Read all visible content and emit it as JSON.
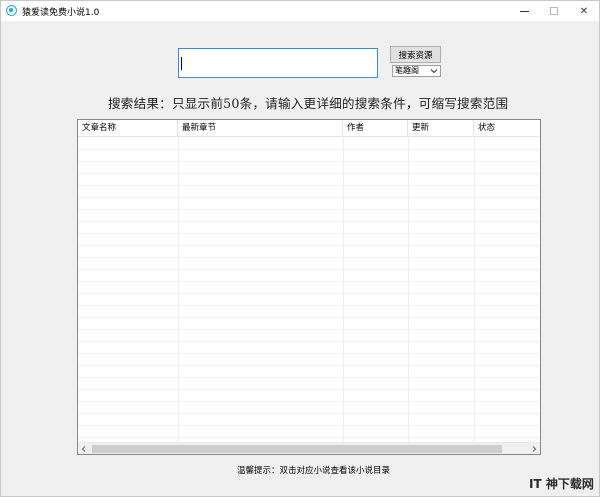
{
  "window": {
    "title": "猿爱读免费小说1.0",
    "controls": {
      "minimize_icon": "minimize-icon",
      "maximize_icon": "maximize-icon",
      "close_glyph": "✕"
    }
  },
  "search": {
    "input_value": "",
    "button_label": "搜索资源",
    "source_select": {
      "selected": "笔趣阁",
      "arrow_icon": "chevron-down-icon"
    }
  },
  "results": {
    "note": "搜索结果：只显示前50条，请输入更详细的搜索条件，可缩写搜索范围",
    "columns": [
      "文章名称",
      "最新章节",
      "作者",
      "更新",
      "状态"
    ],
    "rows": []
  },
  "footer": {
    "tip": "温馨提示：双击对应小说查看该小说目录"
  },
  "watermark": {
    "text": "IT 神下载网"
  },
  "colors": {
    "accent": "#3c8ad8",
    "window_bg": "#f0f0f0",
    "icon": "#3aa6c8"
  }
}
